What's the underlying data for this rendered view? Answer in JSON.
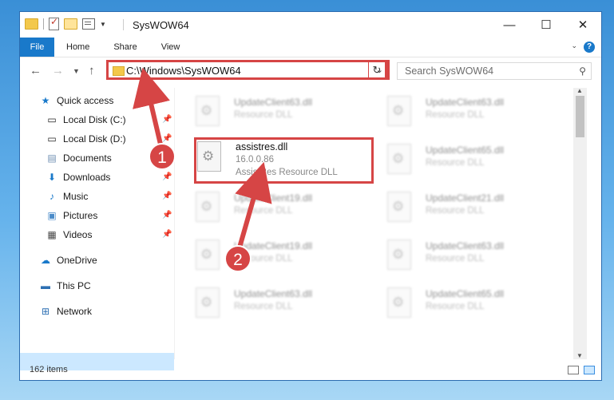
{
  "window": {
    "title": "SysWOW64",
    "controls": {
      "minimize": "—",
      "maximize": "☐",
      "close": "✕"
    }
  },
  "ribbon": {
    "file_tab": "File",
    "tabs": [
      "Home",
      "Share",
      "View"
    ],
    "help": "?"
  },
  "address_bar": {
    "path": "C:\\Windows\\SysWOW64",
    "search_placeholder": "Search SysWOW64"
  },
  "sidebar": {
    "quick_access": "Quick access",
    "items": [
      {
        "label": "Local Disk (C:)",
        "icon": "drive-icon",
        "pinned": true
      },
      {
        "label": "Local Disk (D:)",
        "icon": "drive-icon",
        "pinned": true
      },
      {
        "label": "Documents",
        "icon": "documents-icon",
        "pinned": true
      },
      {
        "label": "Downloads",
        "icon": "download-icon",
        "pinned": true
      },
      {
        "label": "Music",
        "icon": "music-icon",
        "pinned": true
      },
      {
        "label": "Pictures",
        "icon": "pictures-icon",
        "pinned": true
      },
      {
        "label": "Videos",
        "icon": "videos-icon",
        "pinned": true
      }
    ],
    "onedrive": "OneDrive",
    "this_pc": "This PC",
    "network": "Network"
  },
  "files": {
    "highlighted": {
      "name": "assistres.dll",
      "version": "16.0.0.86",
      "description": "AssistRes Resource DLL"
    },
    "background": [
      {
        "name": "UpdateClient63.dll",
        "type": "Resource DLL"
      },
      {
        "name": "UpdateClient63.dll",
        "type": "Resource DLL"
      },
      {
        "name": "UpdateClient65.dll",
        "type": "Resource DLL"
      },
      {
        "name": "UpdateClient19.dll",
        "type": "Resource DLL"
      },
      {
        "name": "UpdateClient21.dll",
        "type": "Resource DLL"
      },
      {
        "name": "UpdateClient19.dll",
        "type": "Resource DLL"
      },
      {
        "name": "UpdateClient63.dll",
        "type": "Resource DLL"
      },
      {
        "name": "UpdateClient63.dll",
        "type": "Resource DLL"
      },
      {
        "name": "UpdateClient65.dll",
        "type": "Resource DLL"
      }
    ]
  },
  "status": {
    "item_count": "162 items"
  },
  "annotations": {
    "step1": "1",
    "step2": "2",
    "accent": "#d64545"
  }
}
